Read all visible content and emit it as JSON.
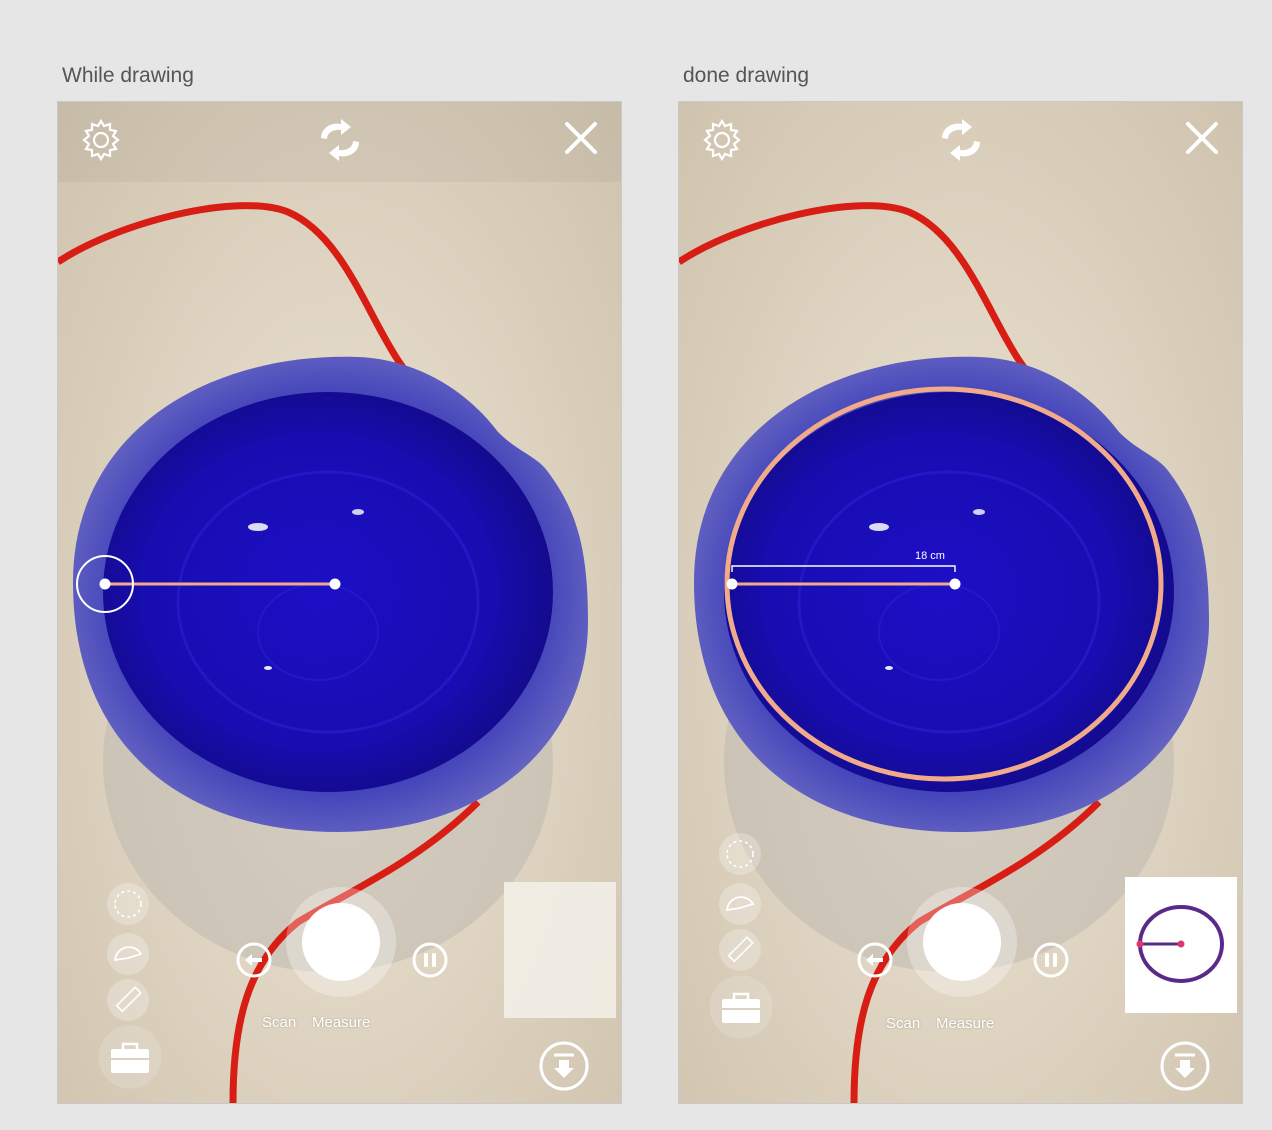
{
  "panels": [
    {
      "caption": "While drawing",
      "scan_label": "Scan",
      "measure_label": "Measure"
    },
    {
      "caption": "done drawing",
      "scan_label": "Scan",
      "measure_label": "Measure",
      "measurement": "18 cm"
    }
  ],
  "icons": {
    "settings": "gear-icon",
    "switch_camera": "switch-camera-icon",
    "close": "close-icon",
    "undo": "undo-icon",
    "pause": "pause-icon",
    "download": "download-icon",
    "toolbox": "toolbox-icon",
    "circle_tool": "dashed-circle-icon",
    "protractor_tool": "protractor-icon",
    "ruler_tool": "ruler-icon"
  },
  "colors": {
    "measure_line": "#f2ab8a",
    "bowl": "#1a0fb8",
    "cable": "#d81e14",
    "thumb_circle": "#5a2a8a",
    "thumb_dot": "#e0356a"
  }
}
